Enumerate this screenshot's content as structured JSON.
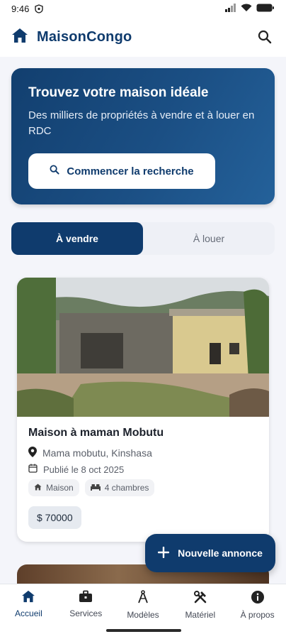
{
  "status_bar": {
    "time": "9:46"
  },
  "app_bar": {
    "title": "MaisonCongo",
    "icons": [
      "home-icon",
      "search-icon"
    ]
  },
  "hero": {
    "title": "Trouvez votre maison idéale",
    "subtitle": "Des milliers de propriétés à vendre et à louer en RDC",
    "cta_label": "Commencer la recherche"
  },
  "tabs": [
    {
      "label": "À vendre",
      "active": true
    },
    {
      "label": "À louer",
      "active": false
    }
  ],
  "listing": {
    "title": "Maison à maman Mobutu",
    "location": "Mama mobutu, Kinshasa",
    "published": "Publié le 8 oct 2025",
    "type": "Maison",
    "bedrooms": "4 chambres",
    "price": "$ 70000"
  },
  "fab": {
    "label": "Nouvelle annonce"
  },
  "bottom_nav": [
    {
      "label": "Accueil",
      "icon": "home-icon",
      "active": true
    },
    {
      "label": "Services",
      "icon": "briefcase-icon",
      "active": false
    },
    {
      "label": "Modèles",
      "icon": "compass-icon",
      "active": false
    },
    {
      "label": "Matériel",
      "icon": "tools-icon",
      "active": false
    },
    {
      "label": "À propos",
      "icon": "info-icon",
      "active": false
    }
  ],
  "colors": {
    "primary": "#0f3b6d",
    "background": "#f4f5fa"
  }
}
